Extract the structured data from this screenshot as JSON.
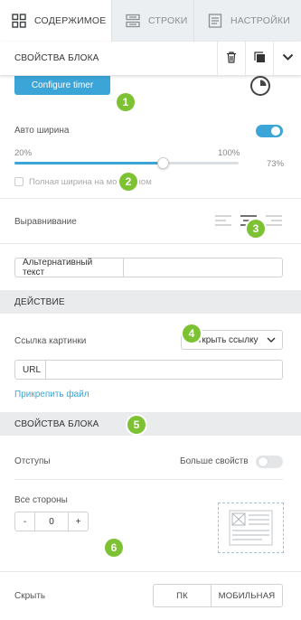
{
  "tabs": [
    {
      "label": "СОДЕРЖИМОЕ",
      "icon": "grid-icon",
      "active": true
    },
    {
      "label": "СТРОКИ",
      "icon": "rows-icon",
      "active": false
    },
    {
      "label": "НАСТРОЙКИ",
      "icon": "settings-doc-icon",
      "active": false
    }
  ],
  "block_header": {
    "title": "СВОЙСТВА БЛОКА",
    "actions": [
      "trash-icon",
      "duplicate-icon",
      "chevron-down-icon"
    ]
  },
  "configure_timer": {
    "label": "Configure timer",
    "icon": "timer-icon"
  },
  "auto_width": {
    "label": "Авто ширина",
    "enabled": true
  },
  "width_slider": {
    "min_label": "20%",
    "max_label": "100%",
    "value_label": "73%",
    "value": 73,
    "min": 20,
    "max": 100
  },
  "full_width_mobile": {
    "label": "Полная ширина на мобильном",
    "checked": false
  },
  "alignment": {
    "label": "Выравнивание",
    "options": [
      "align-left-icon",
      "align-center-icon",
      "align-right-icon"
    ],
    "selected": "center"
  },
  "alt_text": {
    "label": "Альтернативный текст",
    "value": ""
  },
  "action_section": {
    "title": "ДЕЙСТВИЕ"
  },
  "image_link": {
    "label": "Ссылка картинки",
    "selected": "Открыть ссылку"
  },
  "url_field": {
    "label": "URL",
    "value": ""
  },
  "attach_file": {
    "label": "Прикрепить файл"
  },
  "block_props_section": {
    "title": "СВОЙСТВА БЛОКА"
  },
  "padding": {
    "label": "Отступы",
    "more_label": "Больше свойств",
    "more_enabled": false
  },
  "all_sides": {
    "label": "Все стороны",
    "minus": "-",
    "value": "0",
    "plus": "+"
  },
  "hide": {
    "label": "Скрыть",
    "options": [
      "ПК",
      "МОБИЛЬНАЯ"
    ]
  },
  "badges": [
    "1",
    "2",
    "3",
    "4",
    "5",
    "6"
  ],
  "colors": {
    "accent": "#3ba5d8",
    "badge": "#7cc233"
  }
}
